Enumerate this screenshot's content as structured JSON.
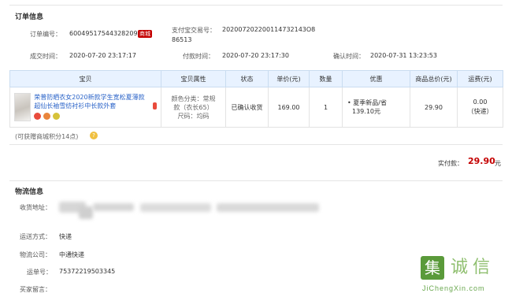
{
  "order_info": {
    "title": "订单信息",
    "order_no_label": "订单编号：",
    "order_no": "6004951754432820941",
    "badge": "商城",
    "alipay_label": "支付宝交易号：",
    "alipay_no_line1": "202007202200114732143O8",
    "alipay_no_line2": "86513",
    "deal_time_label": "成交时间：",
    "deal_time": "2020-07-20 23:17:17",
    "pay_time_label": "付款时间：",
    "pay_time": "2020-07-20 23:17:30",
    "confirm_time_label": "确认时间：",
    "confirm_time": "2020-07-31 13:23:53"
  },
  "table": {
    "headers": [
      "宝贝",
      "宝贝属性",
      "状态",
      "单价(元)",
      "数量",
      "优惠",
      "商品总价(元)",
      "运费(元)"
    ],
    "row": {
      "title": "荣普防晒衣女2020新款学生宽松夏薄款超仙长袖雪纺衬衫中长款外套",
      "attr_line1": "颜色分类：常规",
      "attr_line2": "款（衣长65）",
      "attr_line3": "尺码：均码",
      "status": "已确认收货",
      "price": "169.00",
      "qty": "1",
      "discount_line1": "夏季新品/省",
      "discount_line2": "139.10元",
      "total": "29.90",
      "shipping_line1": "0.00",
      "shipping_line2": "（快递）"
    }
  },
  "points_note": "(可获赠商城积分14点)",
  "paid": {
    "label": "实付款：",
    "amount": "29.90",
    "unit": "元"
  },
  "logistics": {
    "title": "物流信息",
    "address_label": "收货地址：",
    "method_label": "运送方式：",
    "method": "快递",
    "company_label": "物流公司：",
    "company": "中通快递",
    "tracking_label": "运单号：",
    "tracking": "75372219503345",
    "message_label": "买家留言："
  },
  "watermark": {
    "chars": "集诚信",
    "site": "JiChengXin.com"
  },
  "colors": {
    "accent_red": "#c40000",
    "header_bg": "#e8f2ff",
    "link_blue": "#2a63c8",
    "watermark_green": "#5a9a3a"
  }
}
